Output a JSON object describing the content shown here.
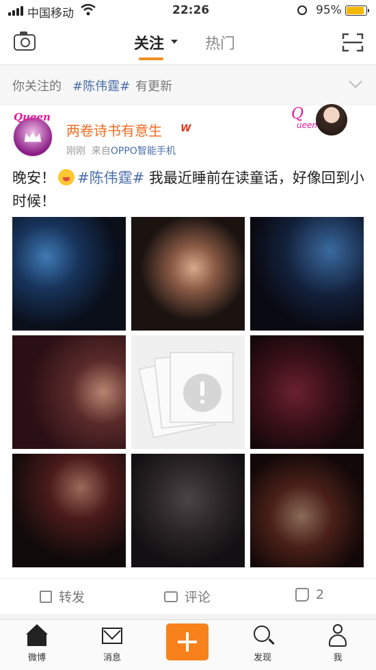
{
  "status_bar": {
    "carrier": "中国移动",
    "time": "22:26",
    "battery_pct": "95%"
  },
  "nav": {
    "tab_follow": "关注",
    "tab_hot": "热门"
  },
  "notice": {
    "prefix": "你关注的",
    "tag": "#陈伟霆#",
    "suffix": "有更新"
  },
  "post": {
    "username": "两卷诗书有意生",
    "member_badge": "W",
    "time": "刚刚",
    "source_prefix": "来自",
    "source": "OPPO智能手机",
    "avatar_text": "Queen",
    "card_badge_text": "Q",
    "card_badge_sub": "ueen",
    "text_before": "晚安！",
    "hashtag": "#陈伟霆#",
    "text_after": " 我最近睡前在读童话，好像回到小时候！",
    "images": [
      {
        "status": "loaded"
      },
      {
        "status": "loaded"
      },
      {
        "status": "loaded"
      },
      {
        "status": "loaded"
      },
      {
        "status": "failed"
      },
      {
        "status": "loaded"
      },
      {
        "status": "loaded"
      },
      {
        "status": "loaded"
      },
      {
        "status": "loaded"
      }
    ]
  },
  "actions": {
    "repost": "转发",
    "comment": "评论",
    "like_count": "2"
  },
  "tabbar": {
    "home": "微博",
    "messages": "消息",
    "discover": "发现",
    "me": "我"
  },
  "colors": {
    "accent": "#f7821b",
    "link": "#4a6ea9",
    "username": "#f06b1f"
  }
}
